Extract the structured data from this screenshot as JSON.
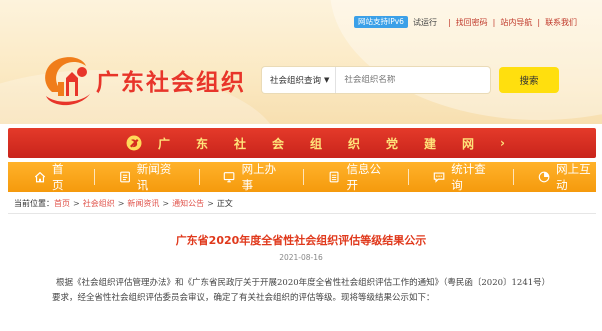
{
  "topbar": {
    "ipv6_badge": "网站支持IPv6",
    "trial_label": "试运行",
    "links": [
      "找回密码",
      "站内导航",
      "联系我们"
    ],
    "separator": "|"
  },
  "site": {
    "title": "广东社会组织",
    "brand_color": "#e8352a"
  },
  "search": {
    "category_label": "社会组织查询",
    "placeholder": "社会组织名称",
    "button_label": "搜索"
  },
  "banner": {
    "chars": [
      "广",
      "东",
      "社",
      "会",
      "组",
      "织",
      "党",
      "建",
      "网"
    ],
    "arrow": "›",
    "color": "#d42c20"
  },
  "nav": {
    "items": [
      {
        "icon": "home-icon",
        "label": "首页"
      },
      {
        "icon": "news-icon",
        "label": "新闻资讯"
      },
      {
        "icon": "monitor-icon",
        "label": "网上办事"
      },
      {
        "icon": "document-icon",
        "label": "信息公开"
      },
      {
        "icon": "chat-icon",
        "label": "统计查询"
      },
      {
        "icon": "pie-chart-icon",
        "label": "网上互动"
      }
    ],
    "color": "#f7a215"
  },
  "breadcrumb": {
    "prefix": "当前位置：",
    "links": [
      "首页",
      "社会组织",
      "新闻资讯",
      "通知公告"
    ],
    "current": "正文",
    "separator": ">"
  },
  "article": {
    "title": "广东省2020年度全省性社会组织评估等级结果公示",
    "date": "2021-08-16",
    "body": "根据《社会组织评估管理办法》和《广东省民政厅关于开展2020年度全省性社会组织评估工作的通知》（粤民函〔2020〕1241号）要求，经全省性社会组织评估委员会审议，确定了有关社会组织的评估等级。现将等级结果公示如下："
  }
}
